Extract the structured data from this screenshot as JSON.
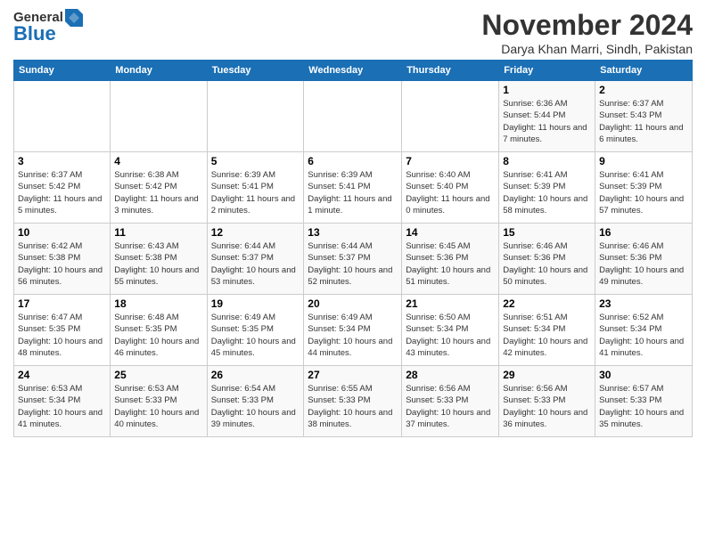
{
  "header": {
    "logo_general": "General",
    "logo_blue": "Blue",
    "month_title": "November 2024",
    "subtitle": "Darya Khan Marri, Sindh, Pakistan"
  },
  "days_of_week": [
    "Sunday",
    "Monday",
    "Tuesday",
    "Wednesday",
    "Thursday",
    "Friday",
    "Saturday"
  ],
  "weeks": [
    [
      {
        "day": "",
        "info": ""
      },
      {
        "day": "",
        "info": ""
      },
      {
        "day": "",
        "info": ""
      },
      {
        "day": "",
        "info": ""
      },
      {
        "day": "",
        "info": ""
      },
      {
        "day": "1",
        "info": "Sunrise: 6:36 AM\nSunset: 5:44 PM\nDaylight: 11 hours and 7 minutes."
      },
      {
        "day": "2",
        "info": "Sunrise: 6:37 AM\nSunset: 5:43 PM\nDaylight: 11 hours and 6 minutes."
      }
    ],
    [
      {
        "day": "3",
        "info": "Sunrise: 6:37 AM\nSunset: 5:42 PM\nDaylight: 11 hours and 5 minutes."
      },
      {
        "day": "4",
        "info": "Sunrise: 6:38 AM\nSunset: 5:42 PM\nDaylight: 11 hours and 3 minutes."
      },
      {
        "day": "5",
        "info": "Sunrise: 6:39 AM\nSunset: 5:41 PM\nDaylight: 11 hours and 2 minutes."
      },
      {
        "day": "6",
        "info": "Sunrise: 6:39 AM\nSunset: 5:41 PM\nDaylight: 11 hours and 1 minute."
      },
      {
        "day": "7",
        "info": "Sunrise: 6:40 AM\nSunset: 5:40 PM\nDaylight: 11 hours and 0 minutes."
      },
      {
        "day": "8",
        "info": "Sunrise: 6:41 AM\nSunset: 5:39 PM\nDaylight: 10 hours and 58 minutes."
      },
      {
        "day": "9",
        "info": "Sunrise: 6:41 AM\nSunset: 5:39 PM\nDaylight: 10 hours and 57 minutes."
      }
    ],
    [
      {
        "day": "10",
        "info": "Sunrise: 6:42 AM\nSunset: 5:38 PM\nDaylight: 10 hours and 56 minutes."
      },
      {
        "day": "11",
        "info": "Sunrise: 6:43 AM\nSunset: 5:38 PM\nDaylight: 10 hours and 55 minutes."
      },
      {
        "day": "12",
        "info": "Sunrise: 6:44 AM\nSunset: 5:37 PM\nDaylight: 10 hours and 53 minutes."
      },
      {
        "day": "13",
        "info": "Sunrise: 6:44 AM\nSunset: 5:37 PM\nDaylight: 10 hours and 52 minutes."
      },
      {
        "day": "14",
        "info": "Sunrise: 6:45 AM\nSunset: 5:36 PM\nDaylight: 10 hours and 51 minutes."
      },
      {
        "day": "15",
        "info": "Sunrise: 6:46 AM\nSunset: 5:36 PM\nDaylight: 10 hours and 50 minutes."
      },
      {
        "day": "16",
        "info": "Sunrise: 6:46 AM\nSunset: 5:36 PM\nDaylight: 10 hours and 49 minutes."
      }
    ],
    [
      {
        "day": "17",
        "info": "Sunrise: 6:47 AM\nSunset: 5:35 PM\nDaylight: 10 hours and 48 minutes."
      },
      {
        "day": "18",
        "info": "Sunrise: 6:48 AM\nSunset: 5:35 PM\nDaylight: 10 hours and 46 minutes."
      },
      {
        "day": "19",
        "info": "Sunrise: 6:49 AM\nSunset: 5:35 PM\nDaylight: 10 hours and 45 minutes."
      },
      {
        "day": "20",
        "info": "Sunrise: 6:49 AM\nSunset: 5:34 PM\nDaylight: 10 hours and 44 minutes."
      },
      {
        "day": "21",
        "info": "Sunrise: 6:50 AM\nSunset: 5:34 PM\nDaylight: 10 hours and 43 minutes."
      },
      {
        "day": "22",
        "info": "Sunrise: 6:51 AM\nSunset: 5:34 PM\nDaylight: 10 hours and 42 minutes."
      },
      {
        "day": "23",
        "info": "Sunrise: 6:52 AM\nSunset: 5:34 PM\nDaylight: 10 hours and 41 minutes."
      }
    ],
    [
      {
        "day": "24",
        "info": "Sunrise: 6:53 AM\nSunset: 5:34 PM\nDaylight: 10 hours and 41 minutes."
      },
      {
        "day": "25",
        "info": "Sunrise: 6:53 AM\nSunset: 5:33 PM\nDaylight: 10 hours and 40 minutes."
      },
      {
        "day": "26",
        "info": "Sunrise: 6:54 AM\nSunset: 5:33 PM\nDaylight: 10 hours and 39 minutes."
      },
      {
        "day": "27",
        "info": "Sunrise: 6:55 AM\nSunset: 5:33 PM\nDaylight: 10 hours and 38 minutes."
      },
      {
        "day": "28",
        "info": "Sunrise: 6:56 AM\nSunset: 5:33 PM\nDaylight: 10 hours and 37 minutes."
      },
      {
        "day": "29",
        "info": "Sunrise: 6:56 AM\nSunset: 5:33 PM\nDaylight: 10 hours and 36 minutes."
      },
      {
        "day": "30",
        "info": "Sunrise: 6:57 AM\nSunset: 5:33 PM\nDaylight: 10 hours and 35 minutes."
      }
    ]
  ]
}
